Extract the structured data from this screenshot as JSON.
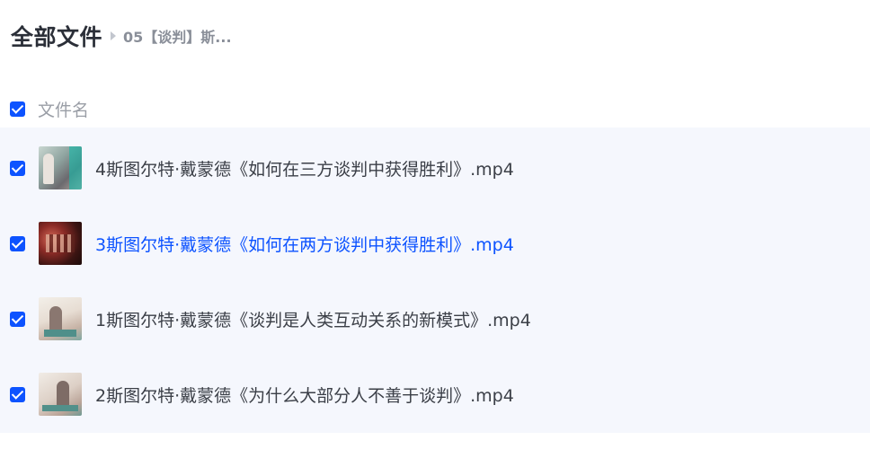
{
  "breadcrumb": {
    "root": "全部文件",
    "current": "05【谈判】斯..."
  },
  "list_header": {
    "name_label": "文件名",
    "select_all_checked": true
  },
  "files": [
    {
      "name": "4斯图尔特·戴蒙德《如何在三方谈判中获得胜利》.mp4",
      "checked": true,
      "highlighted": false
    },
    {
      "name": "3斯图尔特·戴蒙德《如何在两方谈判中获得胜利》.mp4",
      "checked": true,
      "highlighted": true
    },
    {
      "name": "1斯图尔特·戴蒙德《谈判是人类互动关系的新模式》.mp4",
      "checked": true,
      "highlighted": false
    },
    {
      "name": "2斯图尔特·戴蒙德《为什么大部分人不善于谈判》.mp4",
      "checked": true,
      "highlighted": false
    }
  ],
  "colors": {
    "accent": "#0d53ff",
    "list_background": "#f5f7fd",
    "title_text": "#2b2f38",
    "muted_text": "#9a9ea6"
  }
}
